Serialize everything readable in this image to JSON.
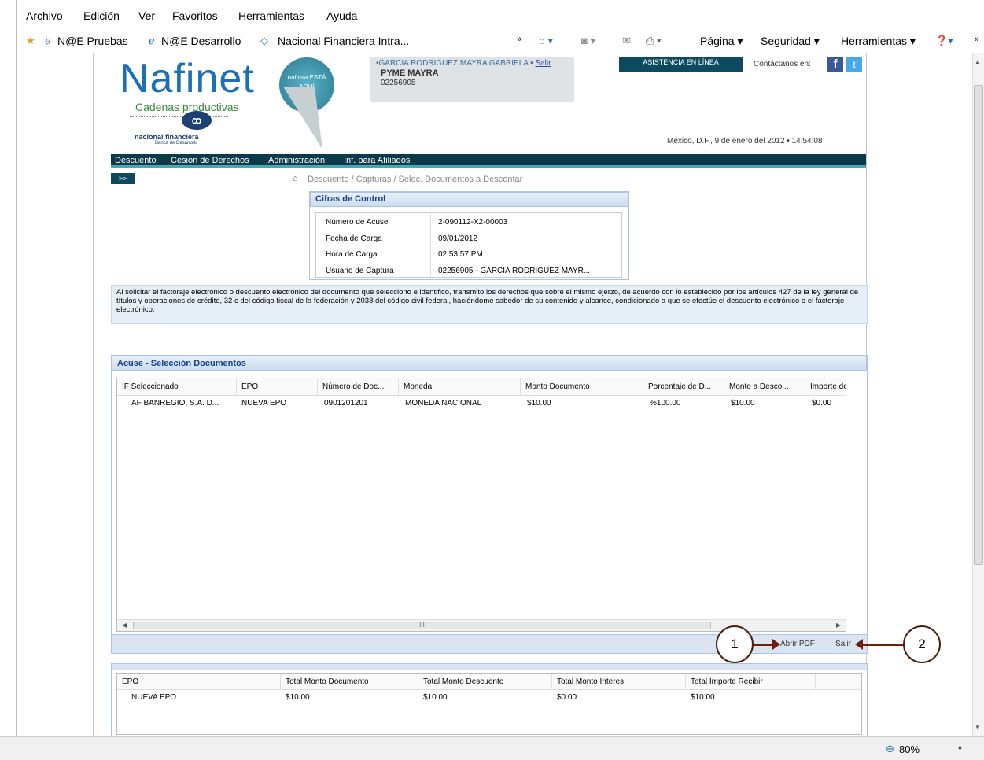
{
  "menu": [
    "Archivo",
    "Edición",
    "Ver",
    "Favoritos",
    "Herramientas",
    "Ayuda"
  ],
  "favorites": {
    "items": [
      "N@E Pruebas",
      "N@E Desarrollo",
      "Nacional Financiera Intra..."
    ],
    "commands": [
      "Página ▾",
      "Seguridad ▾",
      "Herramientas ▾"
    ]
  },
  "site": {
    "logo_text": "Nafinet",
    "logo_sub": "Cadenas productivas",
    "badge": "nafinsa ESTÁ AQUÍ",
    "brand": "nacional financiera",
    "brand_sub": "Banca de Desarrollo"
  },
  "user": {
    "name": "GARCIA RODRIGUEZ MAYRA GABRIELA",
    "logout": "Salir",
    "company": "PYME MAYRA",
    "id": "02256905"
  },
  "assist_button": "ASISTENCIA EN LÍNEA",
  "contact_label": "Contáctanos en:",
  "datetime": "México, D.F., 9 de enero del 2012 • 14:54:08",
  "nav": [
    "Descuento",
    "Cesión de Derechos",
    "Administración",
    "Inf. para Afiliados"
  ],
  "expand_button": ">>",
  "breadcrumb": "Descuento / Capturas / Selec. Documentos a Descontar",
  "control": {
    "title": "Cifras de Control",
    "rows": [
      {
        "label": "Número de Acuse",
        "value": "2-090112-X2-00003"
      },
      {
        "label": "Fecha de Carga",
        "value": "09/01/2012"
      },
      {
        "label": "Hora de Carga",
        "value": "02:53:57 PM"
      },
      {
        "label": "Usuario de Captura",
        "value": "02256905 - GARCIA RODRIGUEZ MAYR..."
      }
    ]
  },
  "legal": "Al solicitar el factoraje electrónico o descuento electrónico del documento que selecciono e identifico, transmito los derechos que sobre el mismo ejerzo, de acuerdo con lo establecido por los artículos 427 de la ley general de títulos y operaciones de crédito, 32 c del código fiscal de la federación y 2038 del código civil federal, haciéndome sabedor de su contenido y alcance, condicionado a que se efectúe el descuento electrónico o el factoraje electrónico.",
  "acuse": {
    "title": "Acuse - Selección Documentos",
    "columns": [
      "IF Seleccionado",
      "EPO",
      "Número de Doc...",
      "Moneda",
      "Monto Documento",
      "Porcentaje de D...",
      "Monto a Desco...",
      "Importe de Int"
    ],
    "row": [
      "AF BANREGIO, S.A. D...",
      "NUEVA EPO",
      "0901201201",
      "MONEDA NACIONAL",
      "$10.00",
      "%100.00",
      "$10.00",
      "$0.00"
    ],
    "scroll_mark": "III"
  },
  "actions": {
    "pdf": "Abrir PDF",
    "exit": "Salir"
  },
  "callouts": [
    "1",
    "2"
  ],
  "totals": {
    "columns": [
      "EPO",
      "Total Monto Documento",
      "Total Monto Descuento",
      "Total Monto Interes",
      "Total Importe Recibir"
    ],
    "row": [
      "NUEVA EPO",
      "$10.00",
      "$10.00",
      "$0.00",
      "$10.00"
    ]
  },
  "zoom": "80%"
}
